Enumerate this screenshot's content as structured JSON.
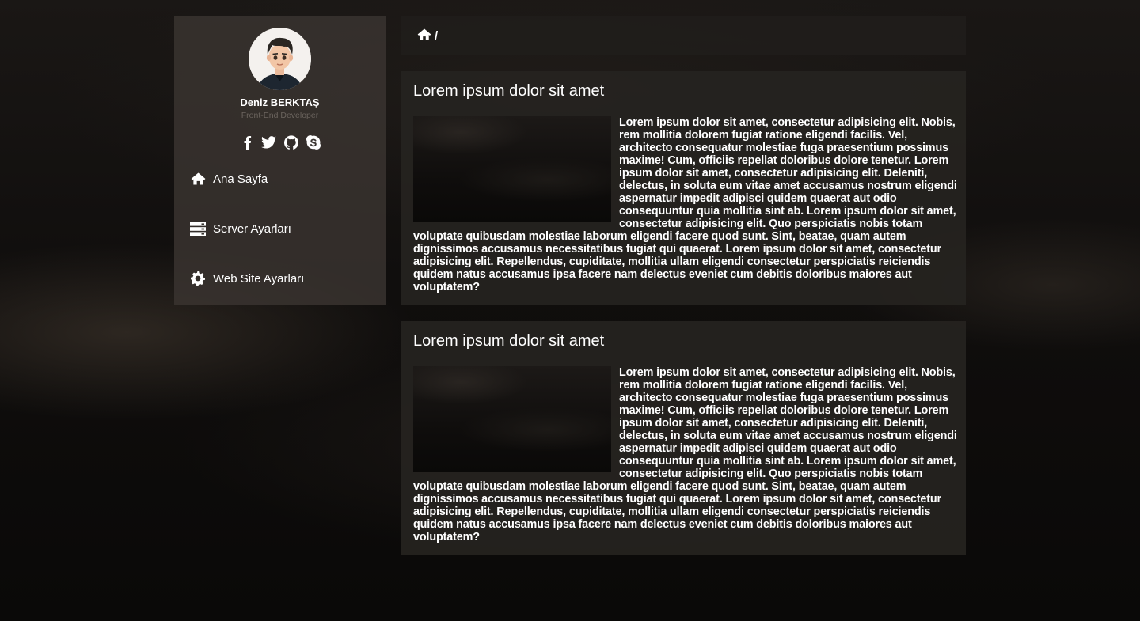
{
  "profile": {
    "name": "Deniz BERKTAŞ",
    "role": "Front-End Developer"
  },
  "social": [
    "facebook-icon",
    "twitter-icon",
    "github-icon",
    "skype-icon"
  ],
  "nav": [
    {
      "label": "Ana Sayfa",
      "icon": "home-icon"
    },
    {
      "label": "Server Ayarları",
      "icon": "server-icon"
    },
    {
      "label": "Web Site Ayarları",
      "icon": "gear-icon"
    }
  ],
  "breadcrumb": {
    "separator": "/"
  },
  "posts": [
    {
      "title": "Lorem ipsum dolor sit amet",
      "body": "Lorem ipsum dolor sit amet, consectetur adipisicing elit. Nobis, rem mollitia dolorem fugiat ratione eligendi facilis. Vel, architecto consequatur molestiae fuga praesentium possimus maxime! Cum, officiis repellat doloribus dolore tenetur. Lorem ipsum dolor sit amet, consectetur adipisicing elit. Deleniti, delectus, in soluta eum vitae amet accusamus nostrum eligendi aspernatur impedit adipisci quidem quaerat aut odio consequuntur quia mollitia sint ab. Lorem ipsum dolor sit amet, consectetur adipisicing elit. Quo perspiciatis nobis totam voluptate quibusdam molestiae laborum eligendi facere quod sunt. Sint, beatae, quam autem dignissimos accusamus necessitatibus fugiat qui quaerat. Lorem ipsum dolor sit amet, consectetur adipisicing elit. Repellendus, cupiditate, mollitia ullam eligendi consectetur perspiciatis reiciendis quidem natus accusamus ipsa facere nam delectus eveniet cum debitis doloribus maiores aut voluptatem?"
    },
    {
      "title": "Lorem ipsum dolor sit amet",
      "body": "Lorem ipsum dolor sit amet, consectetur adipisicing elit. Nobis, rem mollitia dolorem fugiat ratione eligendi facilis. Vel, architecto consequatur molestiae fuga praesentium possimus maxime! Cum, officiis repellat doloribus dolore tenetur. Lorem ipsum dolor sit amet, consectetur adipisicing elit. Deleniti, delectus, in soluta eum vitae amet accusamus nostrum eligendi aspernatur impedit adipisci quidem quaerat aut odio consequuntur quia mollitia sint ab. Lorem ipsum dolor sit amet, consectetur adipisicing elit. Quo perspiciatis nobis totam voluptate quibusdam molestiae laborum eligendi facere quod sunt. Sint, beatae, quam autem dignissimos accusamus necessitatibus fugiat qui quaerat. Lorem ipsum dolor sit amet, consectetur adipisicing elit. Repellendus, cupiditate, mollitia ullam eligendi consectetur perspiciatis reiciendis quidem natus accusamus ipsa facere nam delectus eveniet cum debitis doloribus maiores aut voluptatem?"
    }
  ]
}
